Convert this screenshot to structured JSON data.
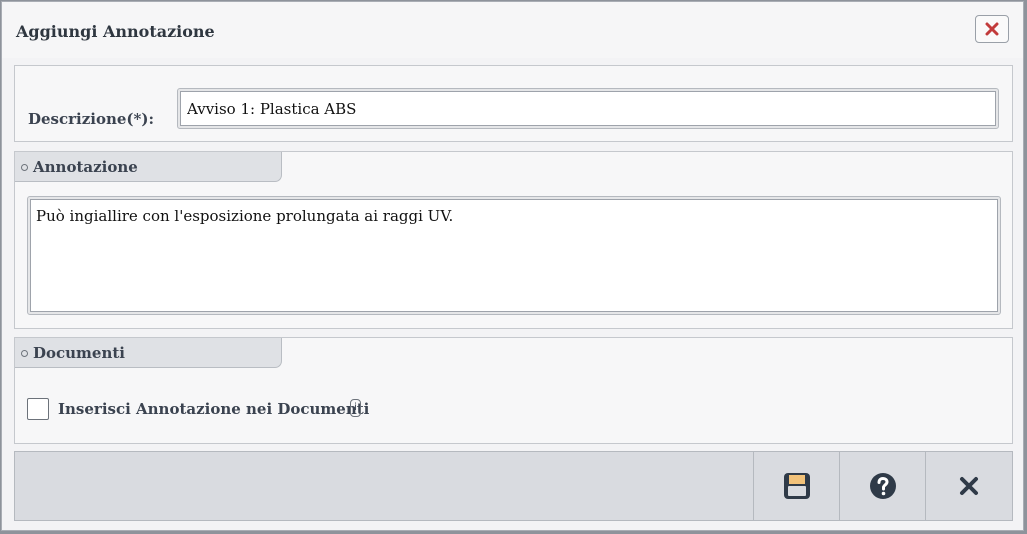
{
  "window": {
    "title": "Aggiungi Annotazione",
    "close_icon": "close-icon"
  },
  "descrizione": {
    "label": "Descrizione(*):",
    "value": "Avviso 1: Plastica ABS"
  },
  "annotazione": {
    "section_title": "Annotazione",
    "value": "Può ingiallire con l'esposizione prolungata ai raggi UV."
  },
  "documenti": {
    "section_title": "Documenti",
    "checkbox_label": "Inserisci Annotazione nei Documenti",
    "checked": false,
    "info_glyph": "i"
  },
  "footer": {
    "buttons": [
      {
        "icon": "save-icon"
      },
      {
        "icon": "help-icon"
      },
      {
        "icon": "close-icon"
      }
    ]
  },
  "colors": {
    "close_x": "#c23b3b",
    "icon_dark": "#2f3a48",
    "save_label": "#f2c27a"
  }
}
